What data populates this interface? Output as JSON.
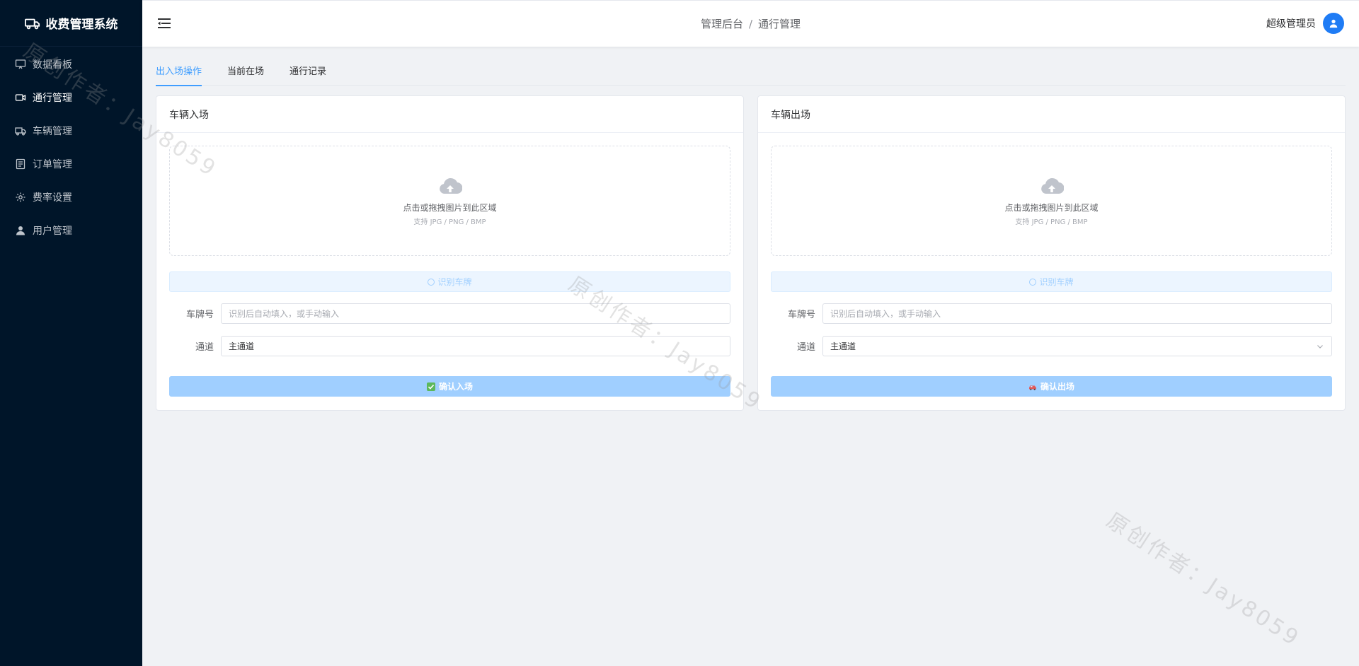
{
  "app": {
    "title": "收费管理系统"
  },
  "sidebar": {
    "items": [
      {
        "label": "数据看板",
        "icon": "monitor-icon",
        "active": false
      },
      {
        "label": "通行管理",
        "icon": "video-camera-icon",
        "active": true
      },
      {
        "label": "车辆管理",
        "icon": "truck-icon",
        "active": false
      },
      {
        "label": "订单管理",
        "icon": "document-icon",
        "active": false
      },
      {
        "label": "费率设置",
        "icon": "gear-icon",
        "active": false
      },
      {
        "label": "用户管理",
        "icon": "user-icon",
        "active": false
      }
    ]
  },
  "header": {
    "breadcrumb": [
      "管理后台",
      "通行管理"
    ],
    "breadcrumb_sep": "/",
    "username": "超级管理员"
  },
  "tabs": [
    {
      "label": "出入场操作",
      "active": true
    },
    {
      "label": "当前在场",
      "active": false
    },
    {
      "label": "通行记录",
      "active": false
    }
  ],
  "entry": {
    "title": "车辆入场",
    "upload_text": "点击或拖拽图片到此区域",
    "upload_tip": "支持 JPG / PNG / BMP",
    "recognize_label": "识别车牌",
    "plate_label": "车牌号",
    "plate_placeholder": "识别后自动填入，或手动输入",
    "channel_label": "通道",
    "channel_value": "主通道",
    "confirm_label": "确认入场"
  },
  "exit": {
    "title": "车辆出场",
    "upload_text": "点击或拖拽图片到此区域",
    "upload_tip": "支持 JPG / PNG / BMP",
    "recognize_label": "识别车牌",
    "plate_label": "车牌号",
    "plate_placeholder": "识别后自动填入，或手动输入",
    "channel_label": "通道",
    "channel_value": "主通道",
    "confirm_label": "确认出场"
  },
  "watermark": "原创作者：Jay8059",
  "colors": {
    "sidebar_bg": "#001529",
    "accent": "#409eff",
    "button_disabled": "#a0cfff",
    "page_bg": "#f0f2f5"
  }
}
